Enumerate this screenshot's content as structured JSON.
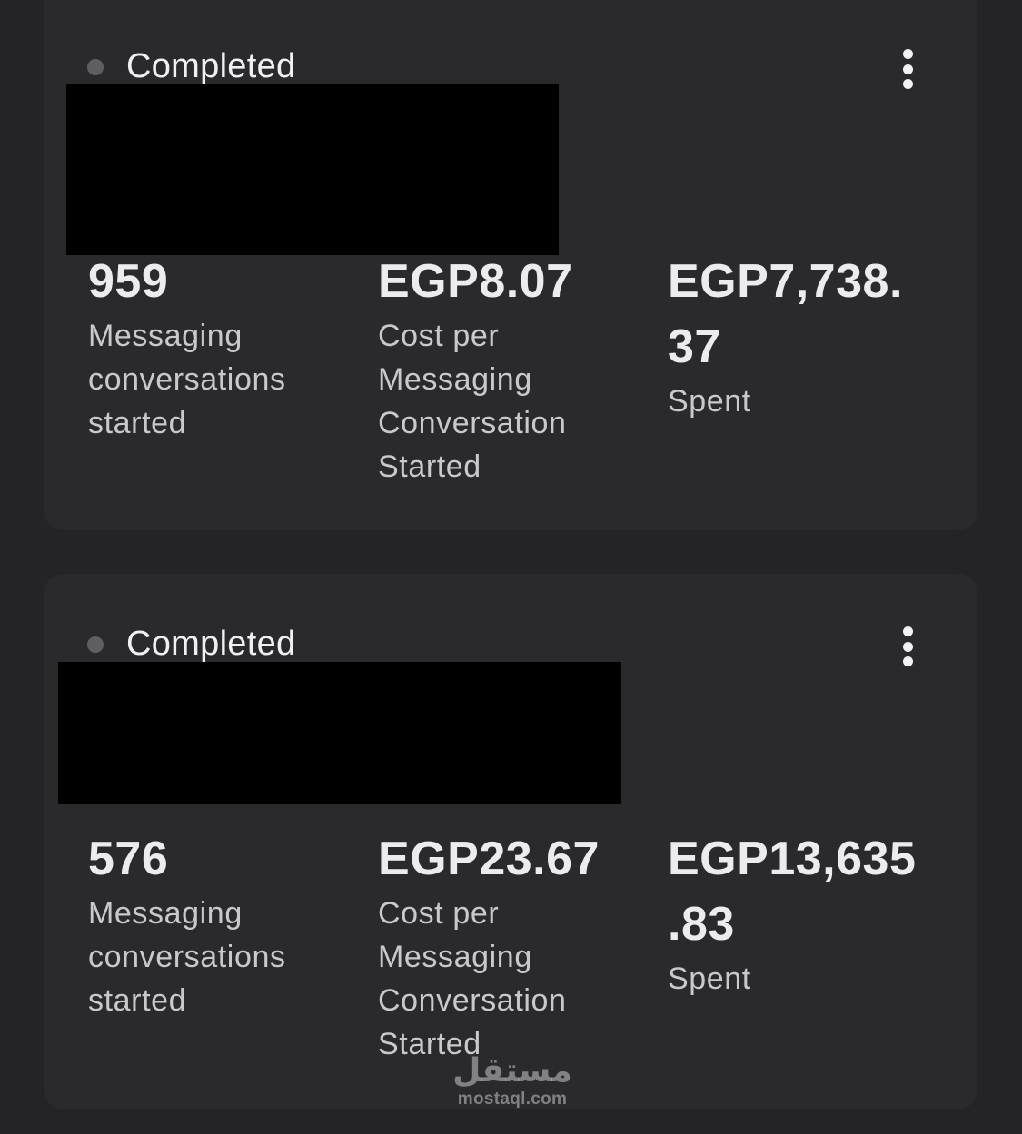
{
  "campaigns": [
    {
      "status": "Completed",
      "menu_icon": "more-vertical-icon",
      "metrics": [
        {
          "value": "959",
          "label_lines": [
            "Messaging",
            "conversations",
            "started"
          ]
        },
        {
          "value": "EGP8.07",
          "label_lines": [
            "Cost per",
            "Messaging",
            "Conversation",
            "Started"
          ]
        },
        {
          "value_lines": [
            "EGP7,738.",
            "37"
          ],
          "label_lines": [
            "Spent"
          ]
        }
      ]
    },
    {
      "status": "Completed",
      "menu_icon": "more-vertical-icon",
      "metrics": [
        {
          "value": "576",
          "label_lines": [
            "Messaging",
            "conversations",
            "started"
          ]
        },
        {
          "value": "EGP23.67",
          "label_lines": [
            "Cost per",
            "Messaging",
            "Conversation",
            "Started"
          ]
        },
        {
          "value_lines": [
            "EGP13,635",
            ".83"
          ],
          "label_lines": [
            "Spent"
          ]
        }
      ]
    }
  ],
  "watermark": {
    "arabic": "مستقل",
    "url": "mostaql.com"
  },
  "colors": {
    "background": "#242426",
    "card": "#2a2a2d",
    "status_dot": "#5f5f63",
    "redaction": "#000000"
  }
}
